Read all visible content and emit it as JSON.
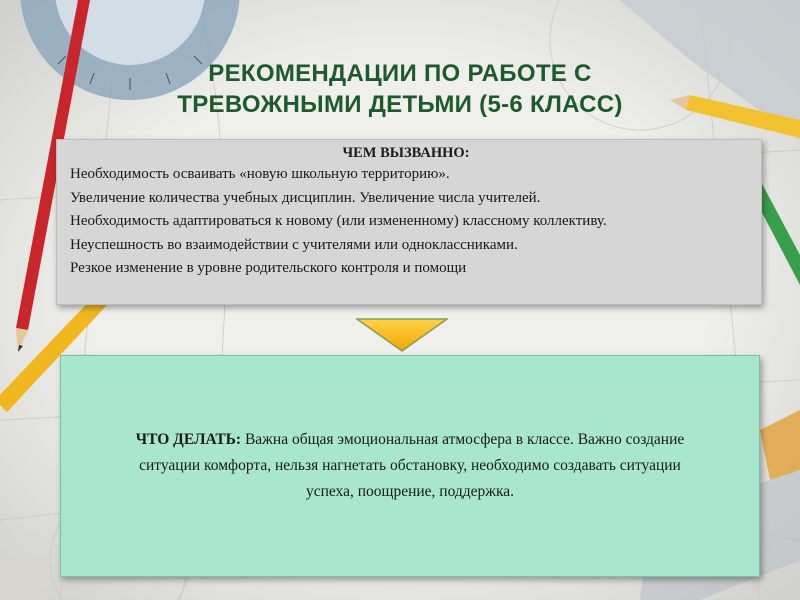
{
  "title": {
    "line1": "РЕКОМЕНДАЦИИ ПО РАБОТЕ С",
    "line2": "ТРЕВОЖНЫМИ ДЕТЬМИ (5-6 КЛАСС)"
  },
  "causes": {
    "heading": "ЧЕМ ВЫЗВАННО:",
    "bullet": "",
    "items": [
      "Необходимость осваивать «новую школьную территорию».",
      "Увеличение количества учебных дисциплин. Увеличение числа учителей.",
      "Необходимость адаптироваться к новому (или измененному) классному коллективу.",
      " Неуспешность во взаимодействии с учителями или одноклассниками.",
      "Резкое изменение в уровне родительского контроля и помощи"
    ]
  },
  "action": {
    "label": "ЧТО ДЕЛАТЬ:",
    "text": " Важна общая эмоциональная атмосфера в классе. Важно создание ситуации комфорта, нельзя нагнетать обстановку, необходимо создавать ситуации успеха, поощрение, поддержка."
  },
  "colors": {
    "title": "#1e5a2c",
    "cause_box": "#d6d6d6",
    "action_box": "#a8e6cf",
    "arrow": "#f5b800"
  }
}
